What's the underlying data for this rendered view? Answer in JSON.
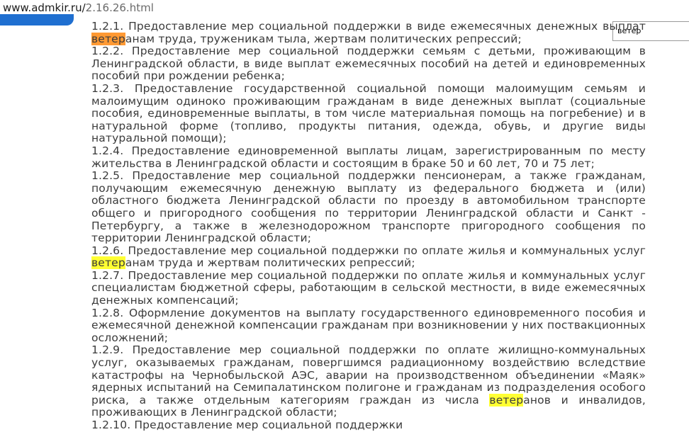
{
  "address_bar": {
    "host": "www.admkir.ru/",
    "path": "2.16.26.html"
  },
  "find_bar": {
    "query": "ветер"
  },
  "document": {
    "paragraphs": [
      {
        "before": "1.2.1. Предоставление мер социальной поддержки в виде ежемесячных денежных выплат ",
        "match": "ветер",
        "after": "анам труда, труженикам тыла, жертвам политических репрессий;",
        "current": true
      },
      {
        "text": "1.2.2. Предоставление мер социальной поддержки семьям с детьми, проживающим в Ленинградской области, в виде выплат ежемесячных пособий на детей и единовременных пособий при рождении ребенка;"
      },
      {
        "text": "1.2.3. Предоставление государственной социальной помощи малоимущим семьям и малоимущим одиноко проживающим гражданам в виде денежных выплат (социальные пособия, единовременные выплаты, в том числе материальная помощь на погребение) и в натуральной форме (топливо, продукты питания, одежда, обувь, и другие виды натуральной помощи);"
      },
      {
        "text": "1.2.4. Предоставление единовременной выплаты лицам, зарегистрированным по месту жительства в Ленинградской области и состоящим в браке 50 и 60 лет, 70 и 75 лет;"
      },
      {
        "text": "1.2.5. Предоставление мер социальной поддержки пенсионерам, а также гражданам, получающим ежемесячную денежную выплату из федерального бюджета и (или) областного бюджета Ленинградской области по проезду в автомобильном транспорте общего и пригородного сообщения по территории Ленинградской области и Санкт - Петербургу, а также в железнодорожном транспорте пригородного сообщения по территории Ленинградской области;"
      },
      {
        "before": "1.2.6. Предоставление мер социальной поддержки по оплате жилья и коммунальных услуг ",
        "match": "ветер",
        "after": "анам труда и жертвам политических репрессий;",
        "current": false
      },
      {
        "text": "1.2.7. Предоставление мер социальной поддержки по оплате жилья и коммунальных услуг специалистам бюджетной сферы, работающим в сельской местности, в виде ежемесячных денежных компенсаций;"
      },
      {
        "text": "1.2.8. Оформление документов на выплату государственного единовременного пособия и ежемесячной денежной компенсации гражданам при возникновении у них поствакционных осложнений;"
      },
      {
        "before": "1.2.9. Предоставление мер социальной поддержки по оплате жилищно-коммунальных услуг, оказываемых гражданам, повергшимся радиационному воздействию вследствие катастрофы на Чернобыльской АЭС, аварии на производственном объединении «Маяк» ядерных испытаний на Семипалатинском полигоне и гражданам из подразделения особого риска, а также отдельным категориям граждан из числа ",
        "match": "ветер",
        "after": "анов и инвалидов, проживающих в Ленинградской области;",
        "current": false
      },
      {
        "text": "1.2.10. Предоставление мер социальной поддержки"
      }
    ]
  },
  "colors": {
    "current_match": "#ff9933",
    "match": "#ffff33",
    "tab_blue": "#1f6fd0"
  }
}
